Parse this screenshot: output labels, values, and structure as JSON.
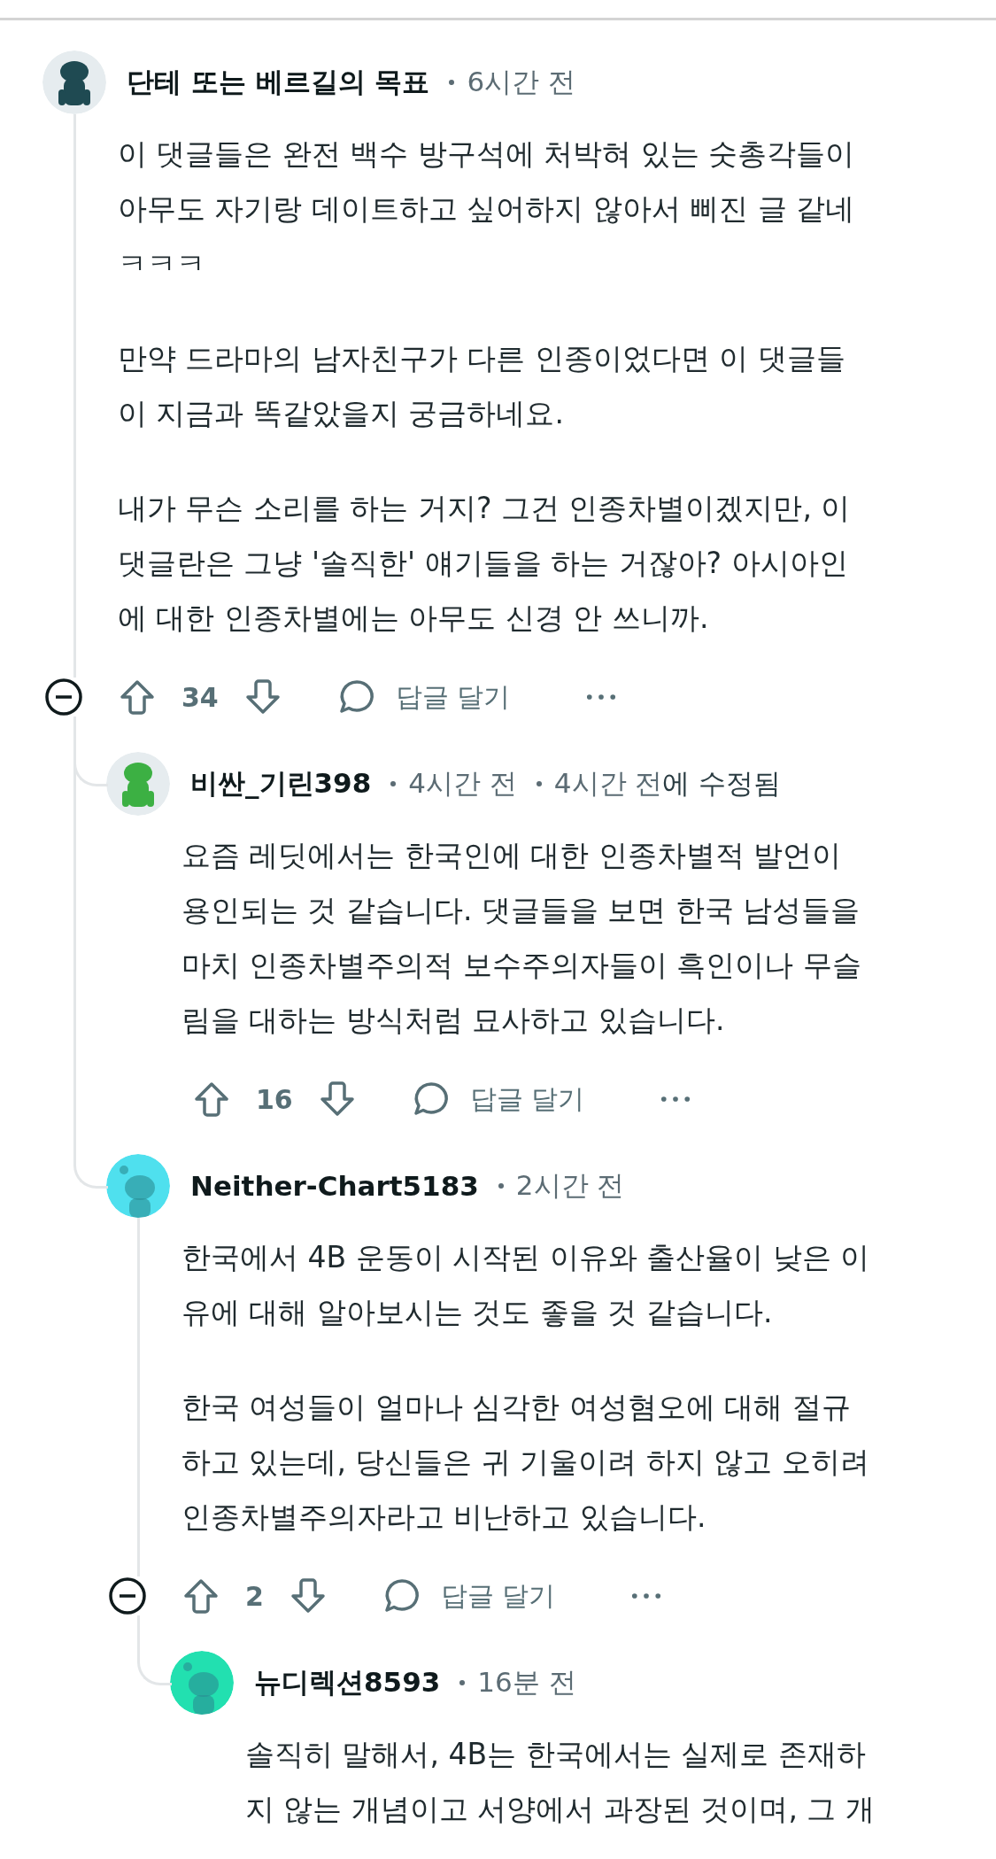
{
  "comments": [
    {
      "author": "단테 또는 베르길의 목표",
      "avatar": {
        "kind": "image",
        "color": "#1f4a52"
      },
      "time": "6시간 전",
      "body": [
        [
          "이 댓글들은 완전 백수 방구석에 처박혀 있는 숫총각들이",
          "아무도 자기랑 데이트하고 싶어하지 않아서 삐진 글 같네",
          "ㅋㅋㅋ"
        ],
        [
          "만약 드라마의 남자친구가 다른 인종이었다면 이 댓글들",
          "이 지금과 똑같았을지 궁금하네요."
        ],
        [
          "내가 무슨 소리를 하는 거지? 그건 인종차별이겠지만, 이",
          "댓글란은 그냥 '솔직한' 얘기들을 하는 거잖아? 아시아인",
          "에 대한 인종차별에는 아무도 신경 안 쓰니까."
        ]
      ],
      "votes": "34",
      "reply_label": "답글 달기",
      "expanded": true,
      "children": [
        {
          "author": "비싼_기린398",
          "avatar": {
            "kind": "image",
            "color": "#3cb043"
          },
          "time": "4시간 전",
          "edited": {
            "time": "4시간 전",
            "suffix": "에 수정됨"
          },
          "body": [
            [
              "요즘 레딧에서는 한국인에 대한 인종차별적 발언이",
              "용인되는 것 같습니다. 댓글들을 보면 한국 남성들을",
              "마치 인종차별주의적 보수주의자들이 흑인이나 무슬",
              "림을 대하는 방식처럼 묘사하고 있습니다."
            ]
          ],
          "votes": "16",
          "reply_label": "답글 달기"
        },
        {
          "author": "Neither-Chart5183",
          "avatar": {
            "kind": "default",
            "color": "#4fe0ee"
          },
          "time": "2시간 전",
          "body": [
            [
              "한국에서 4B 운동이 시작된 이유와 출산율이 낮은 이",
              "유에 대해 알아보시는 것도 좋을 것 같습니다."
            ],
            [
              "한국 여성들이 얼마나 심각한 여성혐오에 대해 절규",
              "하고 있는데, 당신들은 귀 기울이려 하지 않고 오히려",
              "인종차별주의자라고 비난하고 있습니다."
            ]
          ],
          "votes": "2",
          "reply_label": "답글 달기",
          "expanded": true,
          "children": [
            {
              "author": "뉴디렉션8593",
              "avatar": {
                "kind": "default",
                "color": "#22e0b0"
              },
              "time": "16분 전",
              "body": [
                [
                  "솔직히 말해서, 4B는 한국에서는 실제로 존재하",
                  "지 않는 개념이고 서양에서 과장된 것이며, 그 개"
                ]
              ]
            }
          ]
        }
      ]
    }
  ]
}
